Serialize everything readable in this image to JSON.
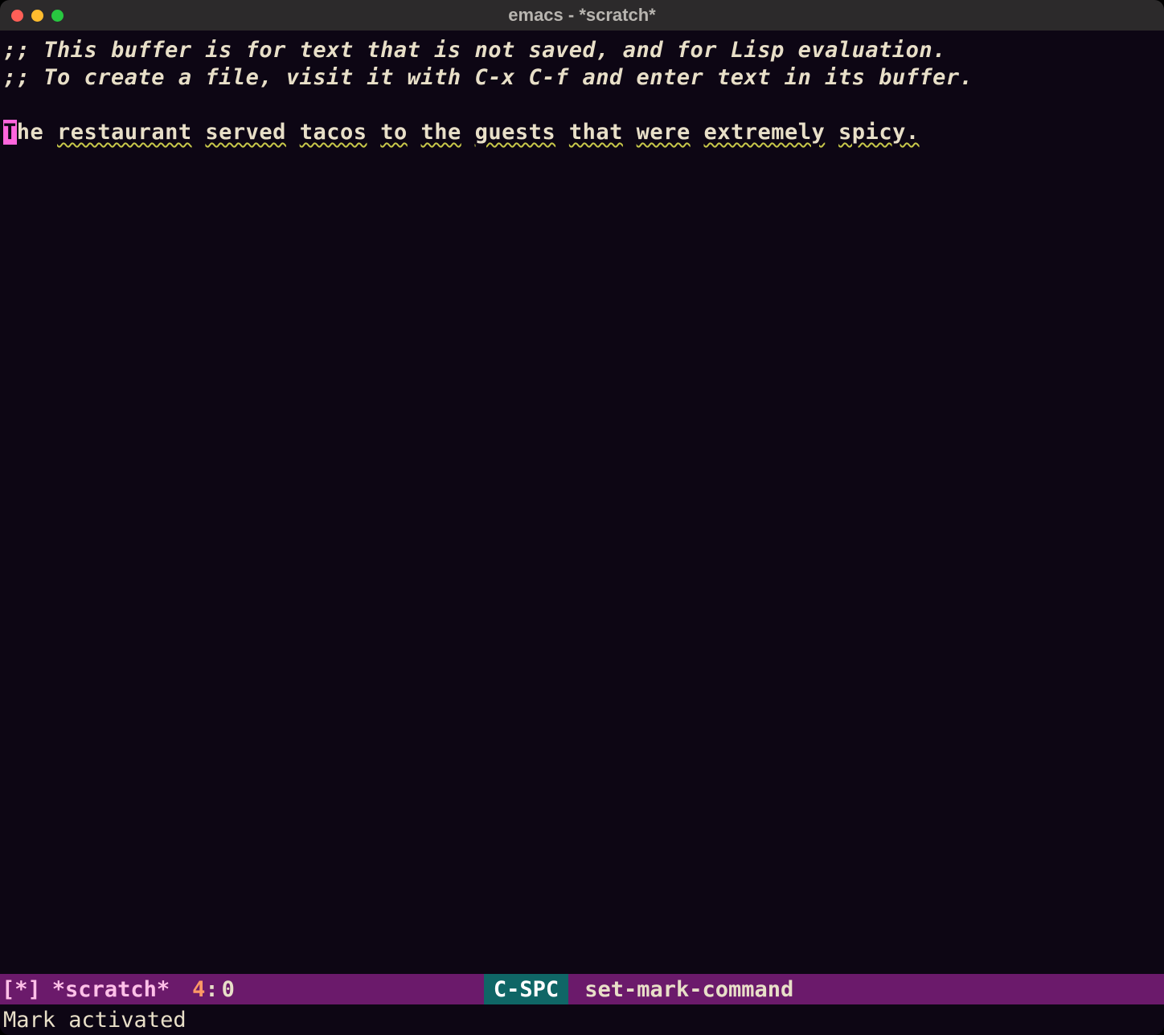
{
  "titlebar": {
    "title": "emacs - *scratch*"
  },
  "editor": {
    "comment_line_1": ";; This buffer is for text that is not saved, and for Lisp evaluation.",
    "comment_line_2": ";; To create a file, visit it with C-x C-f and enter text in its buffer.",
    "cursor_char": "T",
    "post_cursor": "he",
    "words": [
      "restaurant",
      "served",
      "tacos",
      "to",
      "the",
      "guests",
      "that",
      "were",
      "extremely",
      "spicy."
    ]
  },
  "modeline": {
    "bracket_open": "[",
    "modified": "*",
    "bracket_close": "]",
    "buffer_name": "*scratch*",
    "line_no": "4",
    "colon": ":",
    "col_no": "0",
    "keybind": "C-SPC",
    "command": "set-mark-command"
  },
  "echo": {
    "message": "Mark activated"
  }
}
